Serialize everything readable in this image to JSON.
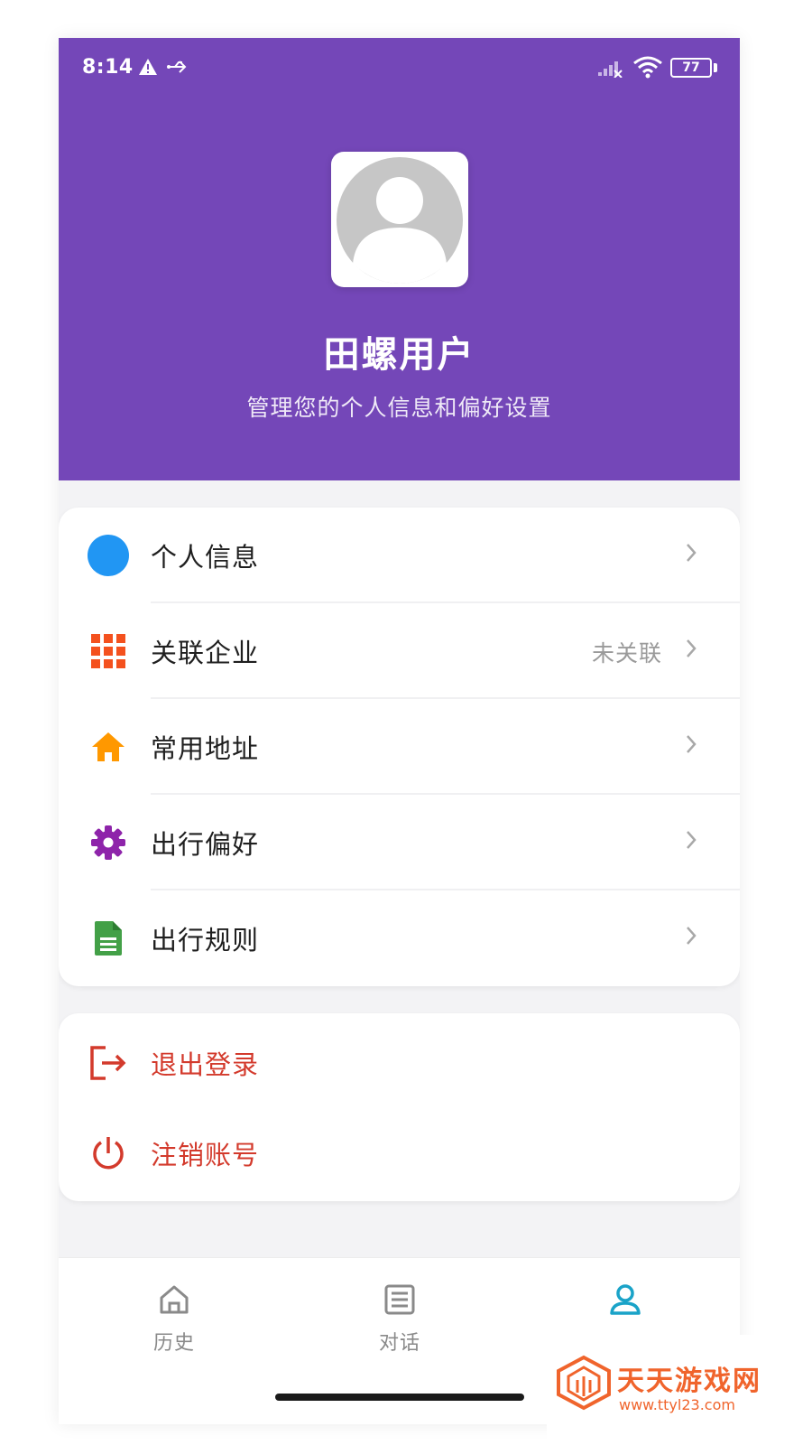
{
  "status_bar": {
    "time": "8:14",
    "battery": "77"
  },
  "profile": {
    "name": "田螺用户",
    "subtitle": "管理您的个人信息和偏好设置"
  },
  "menu": {
    "items": [
      {
        "label": "个人信息",
        "value": "",
        "icon": "profile-dot-icon",
        "color": "#2196f3"
      },
      {
        "label": "关联企业",
        "value": "未关联",
        "icon": "grid-icon",
        "color": "#f4511e"
      },
      {
        "label": "常用地址",
        "value": "",
        "icon": "home-icon",
        "color": "#ff9800"
      },
      {
        "label": "出行偏好",
        "value": "",
        "icon": "gear-icon",
        "color": "#8e24aa"
      },
      {
        "label": "出行规则",
        "value": "",
        "icon": "document-icon",
        "color": "#43a047"
      }
    ]
  },
  "account": {
    "logout_label": "退出登录",
    "deactivate_label": "注销账号",
    "color": "#d33a2c"
  },
  "tabbar": {
    "history_label": "历史",
    "chat_label": "对话",
    "active_color": "#1aa3c8"
  },
  "watermark": {
    "title": "天天游戏网",
    "url": "www.ttyl23.com"
  }
}
